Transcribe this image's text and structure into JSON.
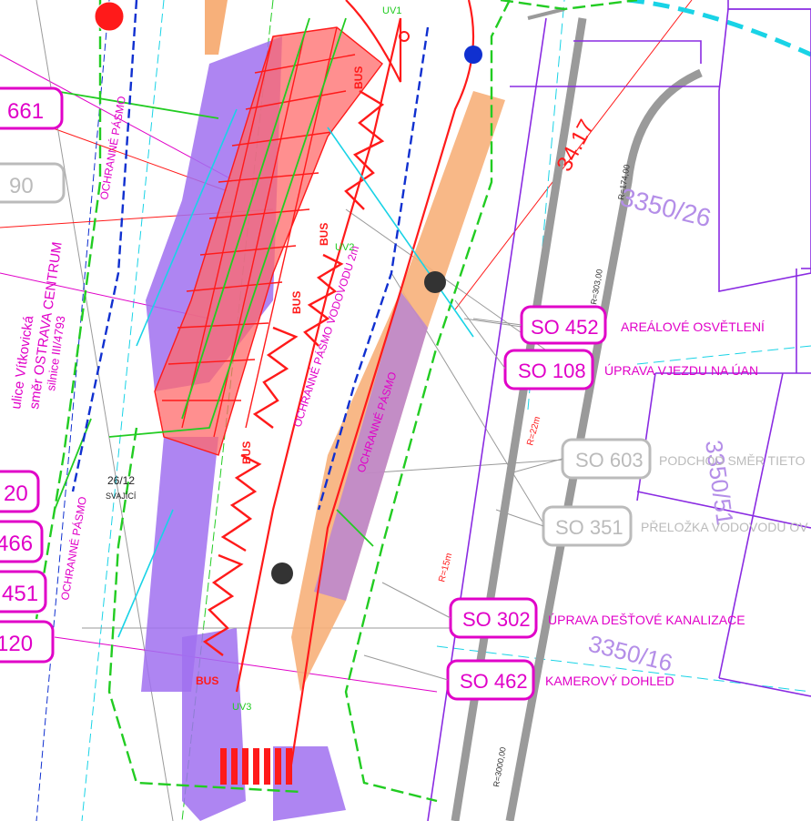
{
  "colors": {
    "magenta": "#e000c8",
    "gray": "#9a9a9a",
    "red": "#ff1a1a",
    "purple": "#a070f0",
    "purple_line": "#8a2be2",
    "green": "#22cc22",
    "orange": "#f7b07a",
    "cyan": "#19d3e6",
    "blue": "#1030d0"
  },
  "so_labels": [
    {
      "code": "SO 452",
      "desc": "AREÁLOVÉ OSVĚTLENÍ",
      "status": "active"
    },
    {
      "code": "SO 108",
      "desc": "ÚPRAVA VJEZDU NA ÚAN",
      "status": "active"
    },
    {
      "code": "SO 603",
      "desc": "PODCHOD SMĚR TIETO",
      "status": "inactive"
    },
    {
      "code": "SO 351",
      "desc": "PŘELOŽKA VODOVODU OV",
      "status": "inactive"
    },
    {
      "code": "SO 302",
      "desc": "ÚPRAVA DEŠŤOVÉ KANALIZACE",
      "status": "active"
    },
    {
      "code": "SO 462",
      "desc": "KAMEROVÝ DOHLED",
      "status": "active"
    }
  ],
  "left_labels": [
    "661",
    "90",
    "20",
    "466",
    "451",
    "120"
  ],
  "parcels": [
    "3350/26",
    "3350/51",
    "3350/16"
  ],
  "dimension": "34.17",
  "street": {
    "name": "ulice Vítkovická",
    "direction": "směr OSTRAVA CENTRUM",
    "road": "silnice III/4793"
  },
  "protection_zones": [
    "OCHRANNÉ PÁSMO",
    "OCHRANNÉ PÁSMO VODOVODU 2m",
    "OCHRANNÉ PÁSMO",
    "OCHRANNÉ PÁSMO"
  ],
  "bus_label": "BUS",
  "misc": {
    "svajici": "26/12",
    "svajici_text": "SVAJÍCÍ",
    "uv_labels": [
      "UV1",
      "UV2",
      "UV3"
    ],
    "radius_labels": [
      "R=22m",
      "R=15m",
      "R=174,00",
      "R=303,00",
      "R=3000,00"
    ]
  }
}
